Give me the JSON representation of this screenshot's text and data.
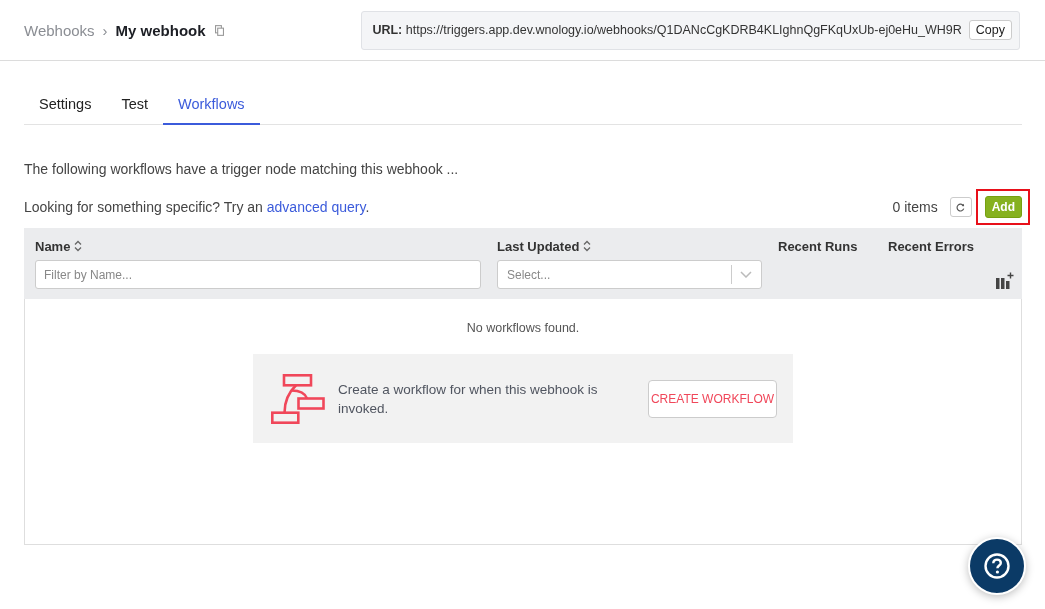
{
  "breadcrumb": {
    "items": [
      {
        "label": "Webhooks",
        "current": false
      },
      {
        "label": "My webhook",
        "current": true
      }
    ],
    "separator": "›"
  },
  "url_box": {
    "label": "URL:",
    "value": "https://triggers.app.dev.wnology.io/webhooks/Q1DANcCgKDRB4KLIghnQgFKqUxUb-ej0eHu_WH9R",
    "copy_button": "Copy"
  },
  "tabs": [
    {
      "label": "Settings",
      "selected": false
    },
    {
      "label": "Test",
      "selected": false
    },
    {
      "label": "Workflows",
      "selected": true
    }
  ],
  "description": "The following workflows have a trigger node matching this webhook ...",
  "query_hint": {
    "before": "Looking for something specific? Try an ",
    "link": "advanced query",
    "after": "."
  },
  "toolbar": {
    "count": "0 items",
    "add_button": {
      "label": "Add",
      "highlighted": true
    }
  },
  "table": {
    "columns": [
      {
        "label": "Name",
        "sortable": true,
        "filter": {
          "kind": "text",
          "placeholder": "Filter by Name..."
        }
      },
      {
        "label": "Last Updated",
        "sortable": true,
        "filter": {
          "kind": "select",
          "placeholder": "Select..."
        }
      },
      {
        "label": "Recent Runs",
        "sortable": false
      },
      {
        "label": "Recent Errors",
        "sortable": false
      }
    ],
    "empty_message": "No workflows found."
  },
  "empty_state": {
    "text": "Create a workflow for when this webhook is invoked.",
    "button": "CREATE WORKFLOW"
  }
}
